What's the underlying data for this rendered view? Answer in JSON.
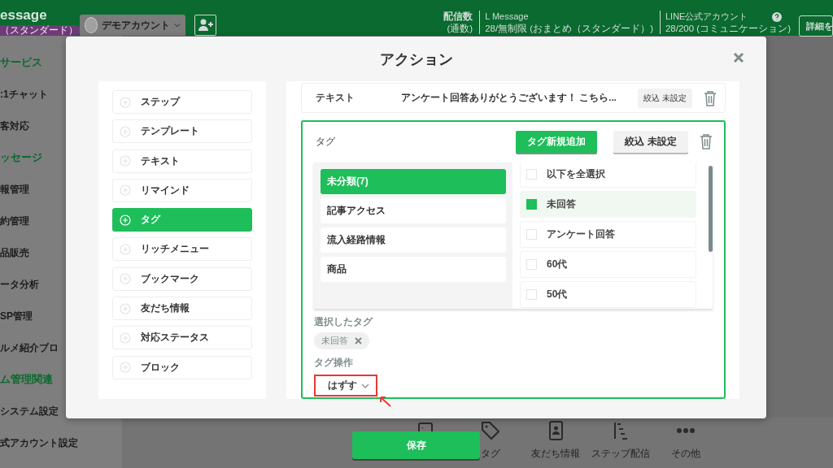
{
  "app_header": {
    "logo": "essage",
    "plan_badge": "（スタンダード）",
    "account": "デモアカウント",
    "stats": [
      {
        "label": "配信数",
        "value": "(通数)"
      },
      {
        "label": "L Message",
        "value": "28/無制限 (おまとめ（スタンダード）)"
      },
      {
        "label": "LINE公式アカウント",
        "value": "28/200 (コミュニケーション)"
      }
    ],
    "detail_button": "詳細を"
  },
  "sidebar": {
    "items": [
      {
        "label": "サービス",
        "kind": "section"
      },
      {
        "label": ":1チャット",
        "kind": "item"
      },
      {
        "label": "客対応",
        "kind": "item"
      },
      {
        "label": "ッセージ",
        "kind": "section"
      },
      {
        "label": "報管理",
        "kind": "item"
      },
      {
        "label": "約管理",
        "kind": "item"
      },
      {
        "label": "品販売",
        "kind": "item"
      },
      {
        "label": "ータ分析",
        "kind": "item"
      },
      {
        "label": "SP管理",
        "kind": "item"
      },
      {
        "label": "ルメ紹介ブロ",
        "kind": "item"
      },
      {
        "label": "ム管理関連",
        "kind": "section"
      },
      {
        "label": "システム設定",
        "kind": "item"
      },
      {
        "label": "式アカウント設定",
        "kind": "item"
      }
    ]
  },
  "bottom_toolbar": [
    {
      "label": "タグ"
    },
    {
      "label": "友だち情報"
    },
    {
      "label": "ステップ配信"
    },
    {
      "label": "その他"
    }
  ],
  "modal": {
    "title": "アクション",
    "action_types": [
      {
        "label": "ステップ",
        "selected": false
      },
      {
        "label": "テンプレート",
        "selected": false
      },
      {
        "label": "テキスト",
        "selected": false
      },
      {
        "label": "リマインド",
        "selected": false
      },
      {
        "label": "タグ",
        "selected": true
      },
      {
        "label": "リッチメニュー",
        "selected": false
      },
      {
        "label": "ブックマーク",
        "selected": false
      },
      {
        "label": "友だち情報",
        "selected": false
      },
      {
        "label": "対応ステータス",
        "selected": false
      },
      {
        "label": "ブロック",
        "selected": false
      }
    ],
    "actions": [
      {
        "kind": "text",
        "label": "テキスト",
        "content": "アンケート回答ありがとうございます！ こちら...",
        "filter": "絞込 未設定"
      },
      {
        "kind": "tag",
        "label": "タグ",
        "add_button": "タグ新規追加",
        "filter": "絞込 未設定",
        "categories": [
          {
            "label": "未分類(7)",
            "selected": true
          },
          {
            "label": "記事アクセス",
            "selected": false
          },
          {
            "label": "流入経路情報",
            "selected": false
          },
          {
            "label": "商品",
            "selected": false
          }
        ],
        "tags": [
          {
            "label": "以下を全選択",
            "checked": false
          },
          {
            "label": "未回答",
            "checked": true
          },
          {
            "label": "アンケート回答",
            "checked": false
          },
          {
            "label": "60代",
            "checked": false
          },
          {
            "label": "50代",
            "checked": false
          }
        ],
        "selected_tags_label": "選択したタグ",
        "selected_tags": [
          "未回答"
        ],
        "operation_label": "タグ操作",
        "operation": "はずす",
        "operation_highlighted": true
      }
    ],
    "save_button": "保存"
  }
}
